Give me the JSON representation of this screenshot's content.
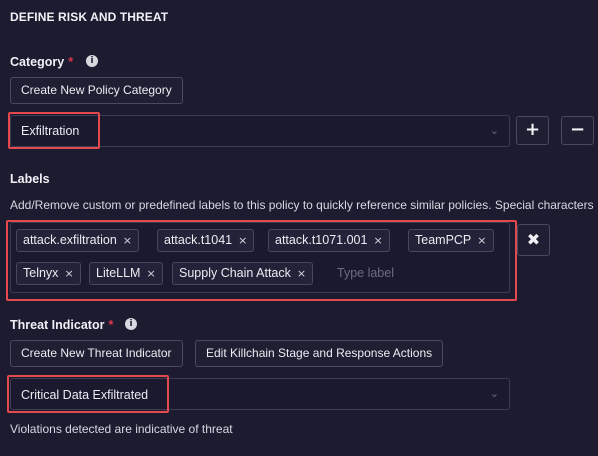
{
  "section": {
    "title": "DEFINE RISK AND THREAT"
  },
  "category": {
    "label": "Category",
    "required_mark": "*",
    "info_icon": "info-icon",
    "create_button": "Create New Policy Category",
    "selected": "Exfiltration",
    "add_icon": "plus-icon",
    "remove_icon": "minus-icon"
  },
  "labels": {
    "label": "Labels",
    "description": "Add/Remove custom or predefined labels to this policy to quickly reference similar policies. Special characters",
    "tags": [
      "attack.exfiltration",
      "attack.t1041",
      "attack.t1071.001",
      "TeamPCP",
      "Telnyx",
      "LiteLLM",
      "Supply Chain Attack"
    ],
    "remove_tag_glyph": "×",
    "placeholder": "Type label",
    "clear_icon": "close-icon"
  },
  "threat": {
    "label": "Threat Indicator",
    "required_mark": "*",
    "info_icon": "info-icon",
    "create_button": "Create New Threat Indicator",
    "edit_button": "Edit Killchain Stage and Response Actions",
    "selected": "Critical Data Exfiltrated",
    "hint": "Violations detected are indicative of threat"
  },
  "colors": {
    "background": "#1c1b30",
    "highlight": "#e5484d",
    "required": "#e0384a"
  }
}
